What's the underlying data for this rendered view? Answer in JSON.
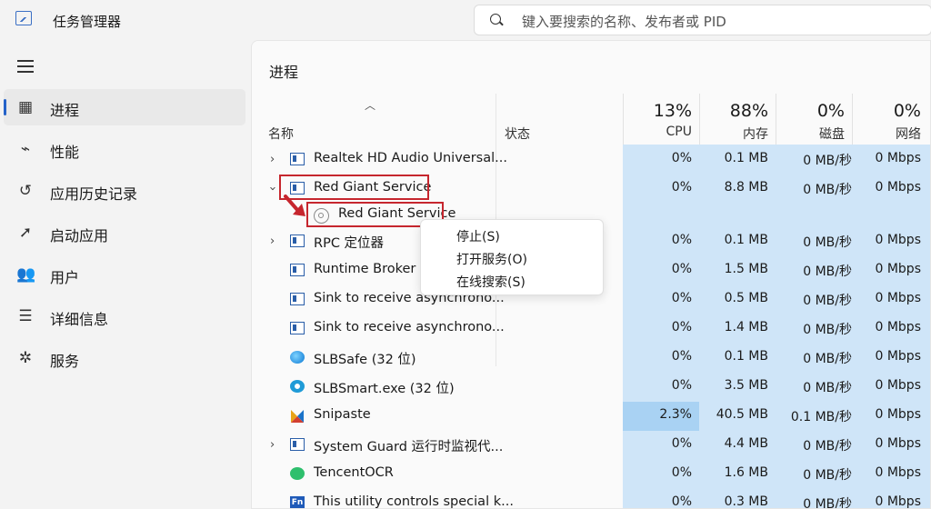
{
  "app": {
    "title": "任务管理器",
    "icon": "task-manager-icon"
  },
  "search": {
    "placeholder": "键入要搜索的名称、发布者或 PID"
  },
  "sidebar": {
    "items": [
      {
        "label": "进程",
        "icon": "processes-icon",
        "active": true
      },
      {
        "label": "性能",
        "icon": "performance-icon"
      },
      {
        "label": "应用历史记录",
        "icon": "app-history-icon"
      },
      {
        "label": "启动应用",
        "icon": "startup-apps-icon"
      },
      {
        "label": "用户",
        "icon": "users-icon"
      },
      {
        "label": "详细信息",
        "icon": "details-icon"
      },
      {
        "label": "服务",
        "icon": "services-icon"
      }
    ]
  },
  "main": {
    "title": "进程",
    "columns": {
      "name": "名称",
      "status": "状态",
      "cpu": {
        "pct": "13%",
        "label": "CPU"
      },
      "memory": {
        "pct": "88%",
        "label": "内存"
      },
      "disk": {
        "pct": "0%",
        "label": "磁盘"
      },
      "network": {
        "pct": "0%",
        "label": "网络"
      }
    },
    "rows": [
      {
        "name": "Realtek HD Audio Universal...",
        "cpu": "0%",
        "mem": "0.1 MB",
        "disk": "0 MB/秒",
        "net": "0 Mbps"
      },
      {
        "name": "Red Giant Service",
        "cpu": "0%",
        "mem": "8.8 MB",
        "disk": "0 MB/秒",
        "net": "0 Mbps"
      },
      {
        "name": "Red Giant Service"
      },
      {
        "name": "RPC 定位器",
        "cpu": "0%",
        "mem": "0.1 MB",
        "disk": "0 MB/秒",
        "net": "0 Mbps"
      },
      {
        "name": "Runtime Broker",
        "cpu": "0%",
        "mem": "1.5 MB",
        "disk": "0 MB/秒",
        "net": "0 Mbps"
      },
      {
        "name": "Sink to receive asynchrono...",
        "cpu": "0%",
        "mem": "0.5 MB",
        "disk": "0 MB/秒",
        "net": "0 Mbps"
      },
      {
        "name": "Sink to receive asynchrono...",
        "cpu": "0%",
        "mem": "1.4 MB",
        "disk": "0 MB/秒",
        "net": "0 Mbps"
      },
      {
        "name": "SLBSafe (32 位)",
        "cpu": "0%",
        "mem": "0.1 MB",
        "disk": "0 MB/秒",
        "net": "0 Mbps"
      },
      {
        "name": "SLBSmart.exe (32 位)",
        "cpu": "0%",
        "mem": "3.5 MB",
        "disk": "0 MB/秒",
        "net": "0 Mbps"
      },
      {
        "name": "Snipaste",
        "cpu": "2.3%",
        "mem": "40.5 MB",
        "disk": "0.1 MB/秒",
        "net": "0 Mbps"
      },
      {
        "name": "System Guard 运行时监视代...",
        "cpu": "0%",
        "mem": "4.4 MB",
        "disk": "0 MB/秒",
        "net": "0 Mbps"
      },
      {
        "name": "TencentOCR",
        "cpu": "0%",
        "mem": "1.6 MB",
        "disk": "0 MB/秒",
        "net": "0 Mbps"
      },
      {
        "name": "This utility controls special k...",
        "cpu": "0%",
        "mem": "0.3 MB",
        "disk": "0 MB/秒",
        "net": "0 Mbps"
      }
    ]
  },
  "context_menu": {
    "items": [
      "停止(S)",
      "打开服务(O)",
      "在线搜索(S)"
    ]
  },
  "colors": {
    "annotation": "#c6262e",
    "metric_bg": "#cfe5f8",
    "accent": "#2563c9"
  }
}
